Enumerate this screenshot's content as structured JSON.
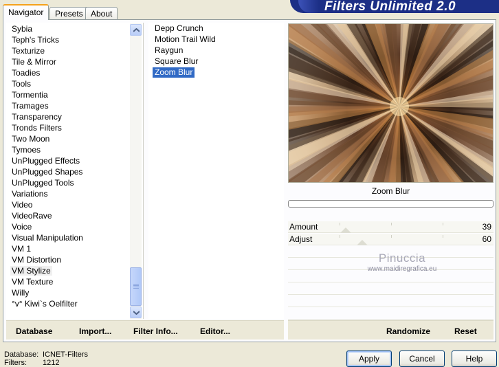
{
  "tabs": [
    {
      "label": "Navigator",
      "active": true
    },
    {
      "label": "Presets",
      "active": false
    },
    {
      "label": "About",
      "active": false
    }
  ],
  "banner_title": "Filters Unlimited 2.0",
  "categories": [
    "Sybia",
    "Teph's Tricks",
    "Texturize",
    "Tile & Mirror",
    "Toadies",
    "Tools",
    "Tormentia",
    "Tramages",
    "Transparency",
    "Tronds Filters",
    "Two Moon",
    "Tymoes",
    "UnPlugged Effects",
    "UnPlugged Shapes",
    "UnPlugged Tools",
    "Variations",
    "Video",
    "VideoRave",
    "Voice",
    "Visual Manipulation",
    "VM 1",
    "VM Distortion",
    "VM Stylize",
    "VM Texture",
    "Willy",
    "°v° Kiwi`s Oelfilter"
  ],
  "selected_category": "VM Stylize",
  "filters": [
    "Depp Crunch",
    "Motion Trail Wild",
    "Raygun",
    "Square Blur",
    "Zoom Blur"
  ],
  "selected_filter": "Zoom Blur",
  "preview": {
    "filter_name": "Zoom Blur",
    "progress": 0
  },
  "sliders": [
    {
      "label": "Amount",
      "value": "39",
      "level": 39
    },
    {
      "label": "Adjust",
      "value": "60",
      "level": 60
    }
  ],
  "watermark": {
    "line1": "Pinuccia",
    "line2": "www.maidiregrafica.eu"
  },
  "toolbar_left": [
    {
      "label": "Database",
      "hotkey": "D"
    },
    {
      "label": "Import...",
      "hotkey": "I"
    },
    {
      "label": "Filter Info...",
      "hotkey": "I"
    },
    {
      "label": "Editor...",
      "hotkey": "E"
    }
  ],
  "toolbar_right": [
    {
      "label": "Randomize"
    },
    {
      "label": "Reset"
    }
  ],
  "status": {
    "database_label": "Database:",
    "database_value": "ICNET-Filters",
    "filters_label": "Filters:",
    "filters_value": "1212"
  },
  "buttons": {
    "apply": "Apply",
    "cancel": "Cancel",
    "help": "Help"
  },
  "colors": {
    "selection": "#316ac5",
    "banner": "#1c2f86",
    "tab_accent": "#f5a21b"
  }
}
